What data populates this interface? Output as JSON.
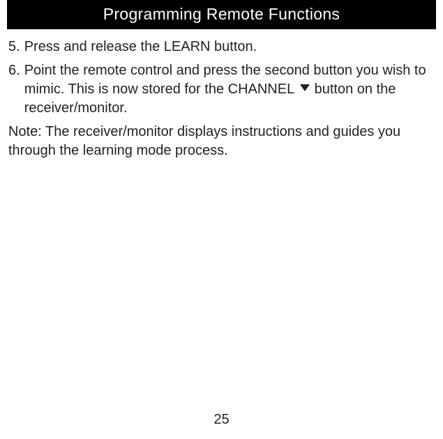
{
  "header": {
    "title": "Programming Remote Functions"
  },
  "items": [
    {
      "num": "5.",
      "text": "Press and release the LEARN button."
    },
    {
      "num": "6.",
      "text_before": "Point the remote control and press the second button you wish to mimic. This is now stored for the CHANNEL ",
      "text_after": " button on the receiver/monitor."
    }
  ],
  "note": "Note: The receiver/monitor displays instructions and guides you through the learning mode process.",
  "page_number": "25"
}
